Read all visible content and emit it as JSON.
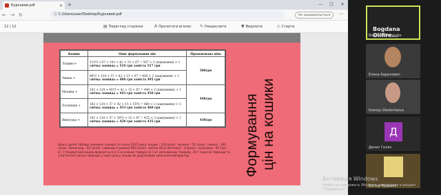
{
  "browser": {
    "tab_title": "Курсовий.pdf",
    "url": "C:/Users/user/Desktop/Курсовий.pdf",
    "sync_label": "Не синхронізується",
    "page_current": "12",
    "page_total": "/ 12",
    "toolbar": {
      "page_view": "Перегляд сторінки",
      "read_aloud": "Прочитати вголос",
      "draw": "Накреслити",
      "highlight": "Виділити",
      "erase": "Стерти"
    }
  },
  "slide": {
    "title_line1": "Формування",
    "title_line2": "цін на кошики",
    "table": {
      "headers": [
        "Кошик",
        "Опис формування цін",
        "Пропонована ціна"
      ],
      "rows": [
        {
          "name": "Лошинс+",
          "desc": "112*2 +57 + 102 + 42 + 15 + 67 = 507 + 2 (пакування) + 1",
          "desc2": "свічка лохвида = 510 грн замість 517 грн",
          "price": "500грн"
        },
        {
          "name": "Омана +",
          "desc": "96*2 + 124 + 57 + 42 + 15 + 67 = 485 + 2 (пакування) + 1",
          "desc2": "свічка лохвида = 488 грн замість 495 грн",
          "price": ""
        },
        {
          "name": "Малина +",
          "desc": "102 + 124 + 45*2 + 42 + 15 + 67 = 440 + 2 (пакування) + 1",
          "desc2": "свічка лохвида = 443 грн замість 450 грн",
          "price": "448грн"
        },
        {
          "name": "Полуниця +",
          "desc": "102 + 124 + 57 + 42 + 15 + 55*2 = 460 + 2 (пакування) + 1",
          "desc2": "свічка лохвида = 453 грн замість 460 грн",
          "price": ""
        },
        {
          "name": "Виноград +",
          "desc": "102 + 124 + 57 + 30*2 + 15 + 67 = 425 + 2 (пакування) + 1",
          "desc2": "свічка лохвида = 428 грн замість 435 грн",
          "price": "430грн"
        }
      ]
    },
    "paragraph": "Ціни у даній таблиці наведені середні за сезон 2021 року: кошик - 122грн/кг, малина - 55 грн/кг, ожина - 100 грн/кг, Виноград - 40 грн/кг, лаванда (сушена) 600 грн/кг, квітка (Біла Ватенка) - 1грн/шт, полуниця - 65 грн/кг. Стандартний кошик формується (з 2 основних товарів по 1 кг допоміжних товарів), 20 г сушеної лаванди та 1 ботанічна свічки лаванди у своїх ціни у кошик як додатковий закономічний фактор."
  },
  "watermark": {
    "line1": "Активація Windows",
    "line2": "Чтобы активировать Windows, перейдите в раздел \"Параметры\"."
  },
  "participants": [
    {
      "name": "Bogdana  Olifire...",
      "label": "Bogdana Olifirenko"
    },
    {
      "name": "Елена Барилович"
    },
    {
      "name": "Ksenija Obolentseva"
    },
    {
      "name": "Денис Гиляк",
      "initial": "Д"
    },
    {
      "name": "Віктор Рудейко"
    }
  ],
  "colors": {
    "slide_bg": "#ef6b77",
    "accent_border": "#c9e85a",
    "avatar_purple": "#9a36b5"
  }
}
